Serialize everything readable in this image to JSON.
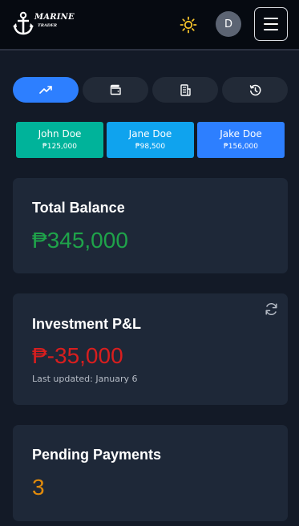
{
  "header": {
    "logo_text": "MARINE",
    "logo_subtext": "TRADER",
    "avatar_initial": "D",
    "theme_icon": "sun-icon",
    "menu_icon": "hamburger-menu-icon",
    "accent_color": "#f6c32a"
  },
  "tabs": [
    {
      "icon": "trending-up-icon",
      "active": true
    },
    {
      "icon": "wallet-icon",
      "active": false
    },
    {
      "icon": "receipt-icon",
      "active": false
    },
    {
      "icon": "history-icon",
      "active": false
    }
  ],
  "people": [
    {
      "name": "John Doe",
      "amount": "₱125,000",
      "color": "#00b39a"
    },
    {
      "name": "Jane Doe",
      "amount": "₱98,500",
      "color": "#0fa3ee"
    },
    {
      "name": "Jake Doe",
      "amount": "₱156,000",
      "color": "#2d7fff"
    }
  ],
  "cards": {
    "total_balance": {
      "title": "Total Balance",
      "value": "₱345,000",
      "color": "#1fa34a"
    },
    "investment": {
      "title": "Investment P&L",
      "value": "₱-35,000",
      "note": "Last updated: January 6",
      "color": "#d91e1e"
    },
    "pending": {
      "title": "Pending Payments",
      "value": "3",
      "color": "#e08a0b"
    }
  }
}
